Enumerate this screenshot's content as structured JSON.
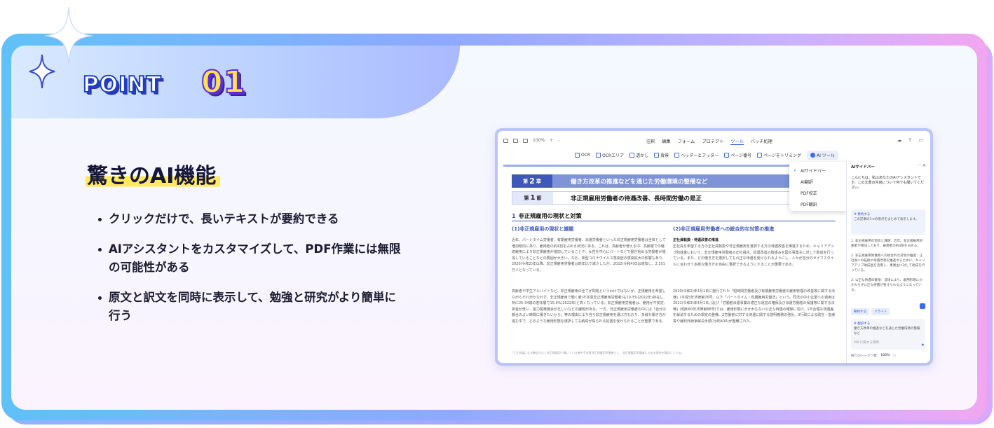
{
  "point": {
    "label": "POINT",
    "number": "01"
  },
  "headline": "驚きのAI機能",
  "bullets": [
    "クリックだけで、長いテキストが要約できる",
    "AIアシスタントをカスタマイズして、PDF作業には無限の可能性がある",
    "原文と訳文を同時に表示して、勉強と研究がより簡単に行う"
  ],
  "app": {
    "zoom": "100%",
    "menu": [
      "注釈",
      "編集",
      "フォーム",
      "プロテクト",
      "ツール",
      "バッチ処理"
    ],
    "active_menu": "ツール",
    "tools": [
      "OCR",
      "OCRエリア",
      "透かし",
      "背景",
      "ヘッダーとフッター",
      "ページ番号",
      "ページをトリミング",
      "AI ツール"
    ],
    "dropdown": [
      "AIサイドバー",
      "AI翻訳",
      "PDF校正",
      "PDF翻訳"
    ],
    "doc": {
      "chapter_prefix": "第",
      "chapter_no": "2",
      "chapter_suffix": "章",
      "chapter_title": "働き方改革の推進などを通じた労働環境の整備など",
      "section_prefix": "第",
      "section_no": "1",
      "section_suffix": "節",
      "section_title": "非正規雇用労働者の待遇改善、長時間労働の是正",
      "heading_no": "1",
      "heading": "非正規雇用の現状と対策",
      "left_col_heading": "(1)非正規雇用の現状と課題",
      "right_col_heading": "(2)非正規雇用労働者への総合的な対策の推進",
      "left_para_1": "近年、パートタイム労働者、有期雇用労働者、派遣労働者といった非正規雇用労働者は全体として増加傾向にあり、雇用者の約4割を占める状況にある。これは、高齢者が増える中、高齢層での継続雇用により非正規雇用が増加していることや、女性を中心にパートなどで働き始める労働者が増加していることなどの要因が大きい。なお、新型コロナウイルス感染症の感染拡大の影響もあり、2020(令和2)年以降、非正規雇用労働者は前年比で減少したが、2022(令和4)年は増加し、2,101万人となっている。",
      "left_para_2": "高齢者や学生アルバイトなど、非正規雇用の全てが問題というわけではないが、正規雇用を希望しながらそれがかなわず、非正規雇用で働く者(不本意非正規雇用労働者)も10.3%(2022年)存在し、特に25-34歳の若年層で15.6%(2022年)と高くなっている。非正規雇用労働者は、雇用が不安定、賃金が低い、能力開発機会が乏しいなどの課題がある。一方、非正規雇用労働者の中には「自分の都合のよい時間に働きたいから」等の理由により自ら非正規雇用を選ぶ方もおり、多様な働き方が進む中で、どのような雇用形態を選択しても納得が得られる処遇を受けられることが重要である。",
      "right_para_1_title": "正社員転換・待遇改善の推進",
      "right_para_1": "正社員を希望する方の正社員転換や非正規雇用を選択する方の待遇改善を推進するため、キャリアアップ助成金において、非正規雇用労働者の正社員化、処遇改善の取組みを図る事業主に対して助成を行っている。また、どの働き方を選択しても公正な待遇を受けられるようにし、人々が自分のライフスタイルに合わせて多様な働き方を自由に選択できるようにすることが重要である。",
      "right_para_2": "2020(令和2)年4月1日に施行された「短時間労働者及び有期雇用労働者の雇用管理の改善等に関する法律」(平成5年法律第76号。以下「パートタイム・有期雇用労働法」という。同法の中小企業への適用は2021(令和3)年4月1日。)及び「労働者派遣事業の適正な運営の確保及び派遣労働者の保護等に関する法律」(昭和60年法律第88号)では、雇用形態にかかわらない公正な待遇の確保に向け、1不合理な待遇差を解消するための規定の整備、2労働者に対する待遇に関する説明義務の強化、3行政による助言・指導等や裁判外紛争解決手続(行政ADR)が整備された。",
      "footnote": "*1 正社員になる機会がなく非正規雇用で働いている者を不本意非正規雇用労働者とし、非正規雇用労働者に占める割合を算出している。"
    },
    "sidebar": {
      "title": "AIサイドバー",
      "greeting": "こんにちは、私はあなたのAIアシスタントです。この文書の内容について何でも聞いてください。",
      "card_label": "# 要約する",
      "card_text": "この記事の3つの要点をまとめて表示します。",
      "list": [
        "1. 非正規雇用の現状と課題：近年、非正規雇用労働者が増加しており、雇用者の約4割を占める。",
        "2. 非正規雇用労働者への総合的な対策の推進：正社員への転換や待遇改善を推進するために、キャリアアップ助成金を活用し、事業主に対して助成を行っている。",
        "3. 公正な待遇の確保：法律により、雇用形態にかかわらず公正な待遇が受けられるようになっている。"
      ],
      "buttons": [
        "要約する",
        "リライト"
      ],
      "box_label": "# 翻訳する",
      "box_text": "働き方改革の推進などを通じた労働環境の整備など",
      "input_placeholder": "PDFに関する質問",
      "footer_label": "残りのトークン数:",
      "footer_value": "100%"
    }
  }
}
